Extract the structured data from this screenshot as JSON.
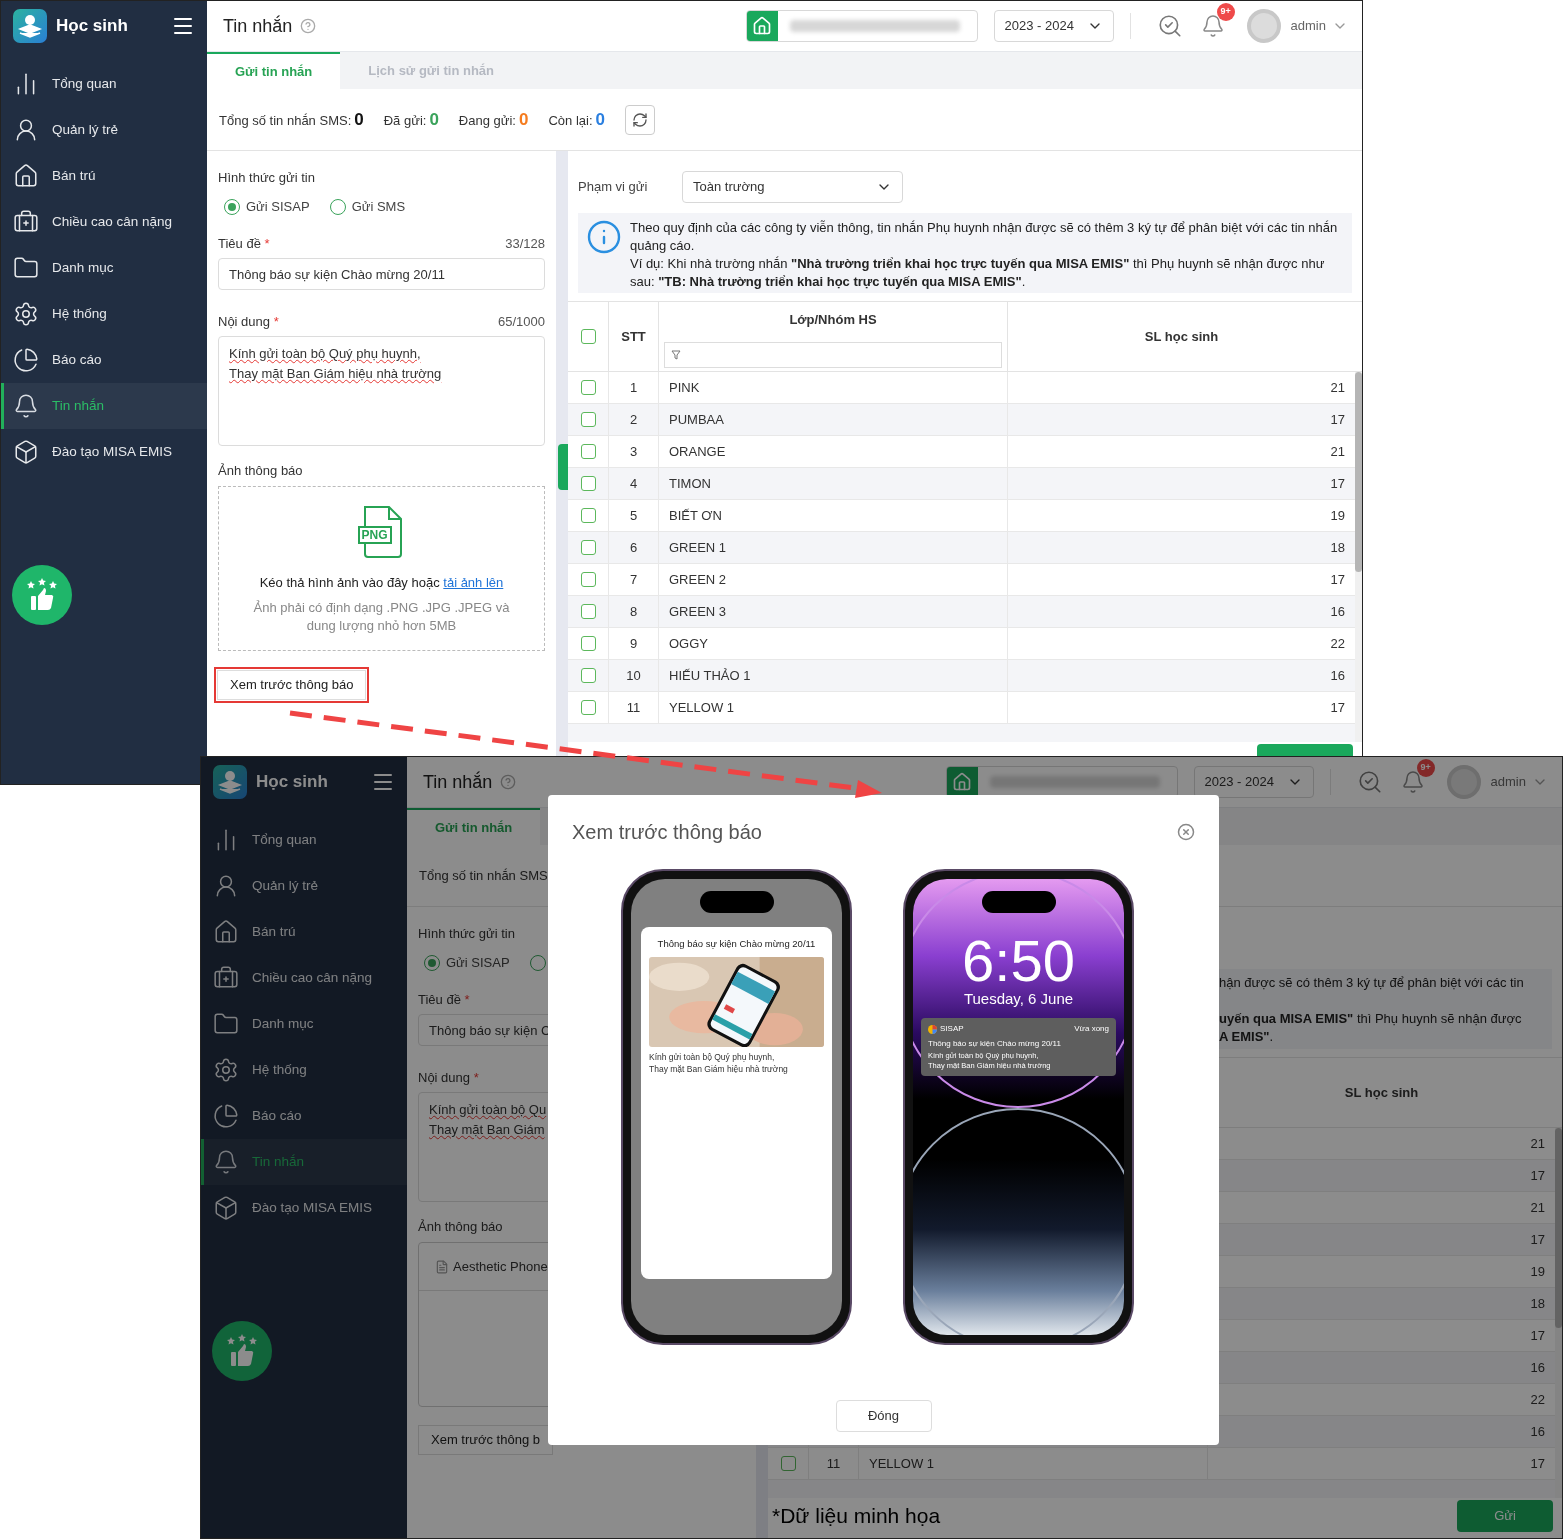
{
  "screen": {
    "sidebar": {
      "title": "Học sinh",
      "items": [
        {
          "label": "Tổng quan",
          "selected": false
        },
        {
          "label": "Quản lý trẻ",
          "selected": false
        },
        {
          "label": "Bán trú",
          "selected": false
        },
        {
          "label": "Chiều cao cân nặng",
          "selected": false
        },
        {
          "label": "Danh mục",
          "selected": false
        },
        {
          "label": "Hệ thống",
          "selected": false
        },
        {
          "label": "Báo cáo",
          "selected": false
        },
        {
          "label": "Tin nhắn",
          "selected": true
        },
        {
          "label": "Đào tạo MISA EMIS",
          "selected": false
        }
      ]
    },
    "header": {
      "title": "Tin nhắn",
      "year": "2023 - 2024",
      "notification_badge": "9+",
      "user": "admin"
    },
    "tabs": [
      {
        "label": "Gửi tin nhắn",
        "selected": true
      },
      {
        "label": "Lịch sử gửi tin nhắn",
        "selected": false
      }
    ],
    "stats": [
      {
        "label": "Tổng số tin nhắn SMS:",
        "value": "0",
        "color": "#111111"
      },
      {
        "label": "Đã gửi:",
        "value": "0",
        "color": "#3aa35b"
      },
      {
        "label": "Đang gửi:",
        "value": "0",
        "color": "#f57c1f"
      },
      {
        "label": "Còn lại:",
        "value": "0",
        "color": "#2a7fe0"
      }
    ],
    "form": {
      "send_method_label": "Hình thức gửi tin",
      "send_methods": [
        {
          "label": "Gửi SISAP",
          "selected": true
        },
        {
          "label": "Gửi SMS",
          "selected": false
        }
      ],
      "title_label": "Tiêu đề",
      "title_mark": "*",
      "title_count": "33/128",
      "title_value": "Thông báo sự kiện Chào mừng 20/11",
      "content_label": "Nội dung",
      "content_mark": "*",
      "content_count": "65/1000",
      "content_lines": [
        "Kính gửi toàn bộ Quý phụ huynh,",
        "Thay mặt Ban Giám hiệu nhà trường"
      ],
      "image_label": "Ảnh thông báo",
      "file_icon_label": "PNG",
      "upload_text": "Kéo thả hình ảnh vào đây hoặc",
      "upload_link": "tải ảnh lên",
      "upload_hint": "Ảnh phải có định dạng .PNG .JPG .JPEG và dung lượng nhỏ hơn 5MB",
      "preview_button": {
        "label": "Xem trước thông báo",
        "highlighted": true
      }
    },
    "scope": {
      "label": "Phạm vi gửi",
      "value": "Toàn trường"
    },
    "notice": [
      "Theo quy định của các công ty viễn thông, tin nhắn Phụ huynh nhận được sẽ có thêm 3 ký tự để phân biệt với các tin nhắn quảng cáo.",
      "Ví dụ: Khi nhà trường nhắn **\"Nhà trường triển khai học trực tuyến qua MISA EMIS\"** thì Phụ huynh sẽ nhận được như sau: **\"TB: Nhà trường triển khai học trực tuyến qua MISA EMIS\"**."
    ],
    "table": {
      "all_checked": false,
      "columns": [
        "STT",
        "Lớp/Nhóm HS",
        "SL học sinh"
      ],
      "rows": [
        {
          "checked": false,
          "stt": "1",
          "name": "PINK",
          "count": "21"
        },
        {
          "checked": false,
          "stt": "2",
          "name": "PUMBAA",
          "count": "17"
        },
        {
          "checked": false,
          "stt": "3",
          "name": "ORANGE",
          "count": "21"
        },
        {
          "checked": false,
          "stt": "4",
          "name": "TIMON",
          "count": "17"
        },
        {
          "checked": false,
          "stt": "5",
          "name": "BIẾT ƠN",
          "count": "19"
        },
        {
          "checked": false,
          "stt": "6",
          "name": "GREEN 1",
          "count": "18"
        },
        {
          "checked": false,
          "stt": "7",
          "name": "GREEN 2",
          "count": "17"
        },
        {
          "checked": false,
          "stt": "8",
          "name": "GREEN 3",
          "count": "16"
        },
        {
          "checked": false,
          "stt": "9",
          "name": "OGGY",
          "count": "22"
        },
        {
          "checked": false,
          "stt": "10",
          "name": "HIẾU THẢO 1",
          "count": "16"
        },
        {
          "checked": false,
          "stt": "11",
          "name": "YELLOW 1",
          "count": "17"
        }
      ]
    }
  },
  "preview_screen": {
    "sidebar": {
      "title": "Học sinh",
      "items": [
        {
          "label": "Tổng quan",
          "selected": false
        },
        {
          "label": "Quản lý trẻ",
          "selected": false
        },
        {
          "label": "Bán trú",
          "selected": false
        },
        {
          "label": "Chiều cao cân nặng",
          "selected": false
        },
        {
          "label": "Danh mục",
          "selected": false
        },
        {
          "label": "Hệ thống",
          "selected": false
        },
        {
          "label": "Báo cáo",
          "selected": false
        },
        {
          "label": "Tin nhắn",
          "selected": true
        },
        {
          "label": "Đào tạo MISA EMIS",
          "selected": false
        }
      ]
    },
    "header": {
      "title": "Tin nhắn",
      "year": "2023 - 2024",
      "notification_badge": "9+",
      "user": "admin"
    },
    "tabs": [
      {
        "label": "Gửi tin nhắn",
        "selected": true
      }
    ],
    "stats_label": "Tổng số tin nhắn SMS",
    "form": {
      "send_method_label": "Hình thức gửi tin",
      "send_methods": [
        {
          "label": "Gửi SISAP",
          "selected": true
        },
        {
          "selected": false
        }
      ],
      "title_label": "Tiêu đề",
      "title_mark": "*",
      "title_value": "Thông báo sự kiện C",
      "content_label": "Nội dung",
      "content_mark": "*",
      "content_lines": [
        "Kính gửi toàn bộ Qu",
        "Thay mặt Ban Giám"
      ],
      "image_label": "Ảnh thông báo",
      "file_name": "Aesthetic Phone",
      "preview_button": "Xem trước thông b"
    },
    "notice_lines": [
      "hận được sẽ có thêm 3 ký tự để phân biệt với các tin",
      "**uyến qua MISA EMIS\"** thì Phụ huynh sẽ nhận được",
      "**A EMIS\"**."
    ],
    "table": {
      "column": "SL học sinh",
      "rows": [
        {
          "count": "21"
        },
        {
          "count": "17"
        },
        {
          "count": "21"
        },
        {
          "count": "17"
        },
        {
          "count": "19"
        },
        {
          "count": "18"
        },
        {
          "count": "17"
        },
        {
          "count": "16"
        },
        {
          "count": "22"
        },
        {
          "count": "16"
        },
        {
          "checked": false,
          "stt": "11",
          "name": "YELLOW 1",
          "count": "17"
        }
      ]
    },
    "footnote": "*Dữ liệu minh họa",
    "send_button": "Gửi",
    "modal": {
      "title": "Xem trước thông báo",
      "app_preview": {
        "title": "Thông báo sự kiện Chào mừng 20/11",
        "lines": [
          "Kính gửi toàn bộ Quý phụ huynh,",
          "Thay mặt Ban Giám hiệu nhà trường"
        ]
      },
      "lock_screen": {
        "time": "6:50",
        "date": "Tuesday, 6 June",
        "notification": {
          "app": "SISAP",
          "time": "Vừa xong",
          "title": "Thông báo sự kiện Chào mừng 20/11",
          "lines": [
            "Kính gửi toàn bộ Quý phụ huynh,",
            "Thay mặt Ban Giám hiệu nhà trường"
          ]
        }
      },
      "close_button": "Đóng"
    }
  }
}
